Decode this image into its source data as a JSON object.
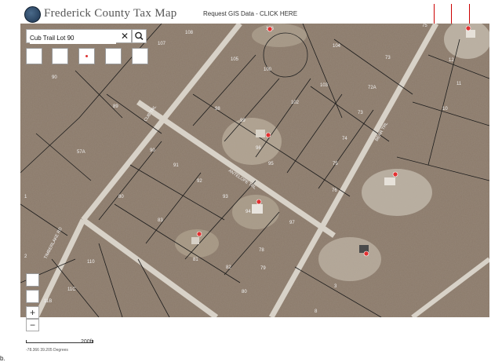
{
  "header": {
    "title": "Frederick County Tax Map",
    "gis_link": "Request GIS Data - CLICK HERE"
  },
  "search": {
    "value": "Cub Trail Lot 90",
    "clear_glyph": "✕"
  },
  "zoom": {
    "in": "+",
    "out": "−"
  },
  "scale": {
    "label": "200ft"
  },
  "coordinates": "-78.366 39.205 Degrees",
  "watermark": "b.",
  "roads": [
    {
      "name": "Cub Trl",
      "label": "CUB TRL"
    },
    {
      "name": "Antelope Trl",
      "label": "ANTELOPE TRL"
    },
    {
      "name": "Timberlake Rd",
      "label": "TIMBERLAKE RD"
    },
    {
      "name": "Bear Trl",
      "label": "BEAR TRL"
    }
  ],
  "lots": [
    "90",
    "91",
    "92",
    "93",
    "94",
    "95",
    "96",
    "97",
    "98",
    "99",
    "100",
    "101",
    "102",
    "103",
    "104",
    "105",
    "106",
    "107",
    "108",
    "109",
    "110",
    "79",
    "80",
    "81",
    "82",
    "83",
    "84",
    "85",
    "86",
    "87",
    "88",
    "89",
    "72A",
    "10",
    "11",
    "12",
    "1",
    "2",
    "3",
    "8",
    "57A"
  ],
  "icons": [
    "search-icon",
    "tool-icon",
    "pin-icon"
  ]
}
